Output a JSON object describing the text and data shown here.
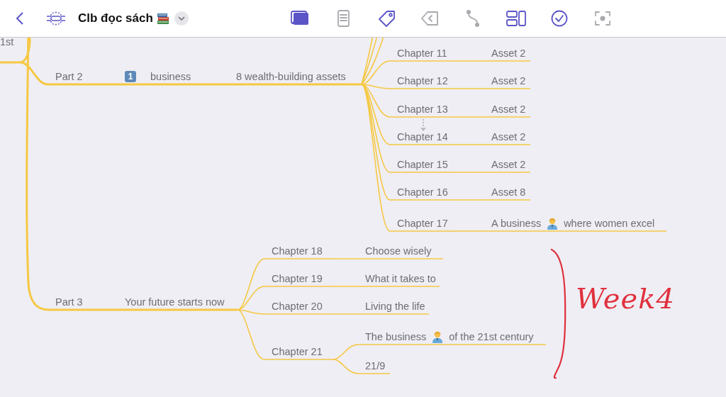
{
  "toolbar": {
    "title": "Clb đọc sách",
    "tools": [
      {
        "disabled": false
      },
      {
        "disabled": true
      },
      {
        "disabled": false
      },
      {
        "disabled": true
      },
      {
        "disabled": true
      },
      {
        "disabled": false
      },
      {
        "disabled": false
      },
      {
        "disabled": true
      }
    ]
  },
  "map": {
    "root_partial": "1st",
    "parts": [
      {
        "label": "Part 2",
        "children": [
          {
            "badge": "1",
            "label": "business",
            "children": [
              {
                "label": "8 wealth-building assets",
                "children": [
                  {
                    "label": "Chapter 11",
                    "children": [
                      {
                        "label": "Asset 2"
                      }
                    ]
                  },
                  {
                    "label": "Chapter 12",
                    "children": [
                      {
                        "label": "Asset 2"
                      }
                    ]
                  },
                  {
                    "label": "Chapter 13",
                    "children": [
                      {
                        "label": "Asset 2"
                      }
                    ]
                  },
                  {
                    "label": "Chapter 14",
                    "children": [
                      {
                        "label": "Asset 2"
                      }
                    ]
                  },
                  {
                    "label": "Chapter 15",
                    "children": [
                      {
                        "label": "Asset 2"
                      }
                    ]
                  },
                  {
                    "label": "Chapter 16",
                    "children": [
                      {
                        "label": "Asset 8"
                      }
                    ]
                  },
                  {
                    "label": "Chapter 17",
                    "children": [
                      {
                        "label": "A business",
                        "icon": true,
                        "label_after": "where women excel"
                      }
                    ]
                  }
                ]
              }
            ]
          }
        ]
      },
      {
        "label": "Part 3",
        "children": [
          {
            "label": "Your future starts now",
            "children": [
              {
                "label": "Chapter 18",
                "children": [
                  {
                    "label": "Choose wisely"
                  }
                ]
              },
              {
                "label": "Chapter 19",
                "children": [
                  {
                    "label": "What it takes to"
                  }
                ]
              },
              {
                "label": "Chapter 20",
                "children": [
                  {
                    "label": "Living the life"
                  }
                ]
              },
              {
                "label": "Chapter 21",
                "children": [
                  {
                    "label": "The business",
                    "icon": true,
                    "label_after": "of the 21st century"
                  },
                  {
                    "label": "21/9"
                  }
                ]
              }
            ]
          }
        ]
      }
    ]
  },
  "annotation": {
    "text": "Week4"
  }
}
